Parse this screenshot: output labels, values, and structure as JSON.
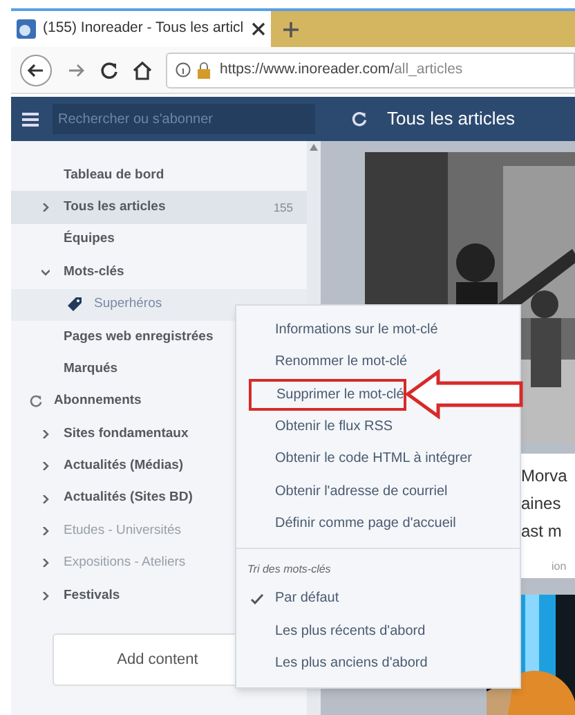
{
  "browser": {
    "tab_title": "(155) Inoreader - Tous les articl",
    "url_host": "https://www.inoreader.com/",
    "url_path": "all_articles"
  },
  "header": {
    "search_placeholder": "Rechercher ou s'abonner",
    "title": "Tous les articles"
  },
  "sidebar": {
    "items": [
      {
        "kind": "link",
        "label": "Tableau de bord",
        "selected": false
      },
      {
        "kind": "folder",
        "label": "Tous les articles",
        "count": "155",
        "expanded": false,
        "dimmed": false,
        "selected": true
      },
      {
        "kind": "link",
        "label": "Équipes",
        "selected": false
      },
      {
        "kind": "folder",
        "label": "Mots-clés",
        "expanded": true,
        "dimmed": false,
        "selected": false
      },
      {
        "kind": "tag",
        "label": "Superhéros",
        "selected": true
      },
      {
        "kind": "link",
        "label": "Pages web enregistrées",
        "selected": false
      },
      {
        "kind": "link",
        "label": "Marqués",
        "selected": false
      },
      {
        "kind": "section",
        "label": "Abonnements",
        "selected": false
      },
      {
        "kind": "folder",
        "label": "Sites fondamentaux",
        "expanded": false,
        "dimmed": false,
        "selected": false
      },
      {
        "kind": "folder",
        "label": "Actualités (Médias)",
        "expanded": false,
        "dimmed": false,
        "selected": false
      },
      {
        "kind": "folder",
        "label": "Actualités (Sites BD)",
        "expanded": false,
        "dimmed": false,
        "selected": false
      },
      {
        "kind": "folder",
        "label": "Etudes - Universités",
        "expanded": false,
        "dimmed": true,
        "selected": false
      },
      {
        "kind": "folder",
        "label": "Expositions - Ateliers",
        "expanded": false,
        "dimmed": true,
        "selected": false
      },
      {
        "kind": "folder",
        "label": "Festivals",
        "expanded": false,
        "dimmed": false,
        "selected": false
      }
    ],
    "add_button": "Add content"
  },
  "article": {
    "title_lines": [
      "Morva",
      "aines",
      "ast m"
    ],
    "meta": "ion"
  },
  "context_menu": {
    "items": [
      {
        "kind": "action",
        "label": "Informations sur le mot-clé",
        "annotated": false
      },
      {
        "kind": "action",
        "label": "Renommer le mot-clé",
        "annotated": false
      },
      {
        "kind": "action",
        "label": "Supprimer le mot-clé",
        "annotated": true
      },
      {
        "kind": "action",
        "label": "Obtenir le flux RSS",
        "annotated": false
      },
      {
        "kind": "action",
        "label": "Obtenir le code HTML à intégrer",
        "annotated": false
      },
      {
        "kind": "action",
        "label": "Obtenir l'adresse de courriel",
        "annotated": false
      },
      {
        "kind": "action",
        "label": "Définir comme page d'accueil",
        "annotated": false
      },
      {
        "kind": "heading",
        "label": "Tri des mots-clés"
      },
      {
        "kind": "sort",
        "label": "Par défaut",
        "checked": true
      },
      {
        "kind": "sort",
        "label": "Les plus récents d'abord",
        "checked": false
      },
      {
        "kind": "sort",
        "label": "Les plus anciens d'abord",
        "checked": false
      }
    ]
  }
}
